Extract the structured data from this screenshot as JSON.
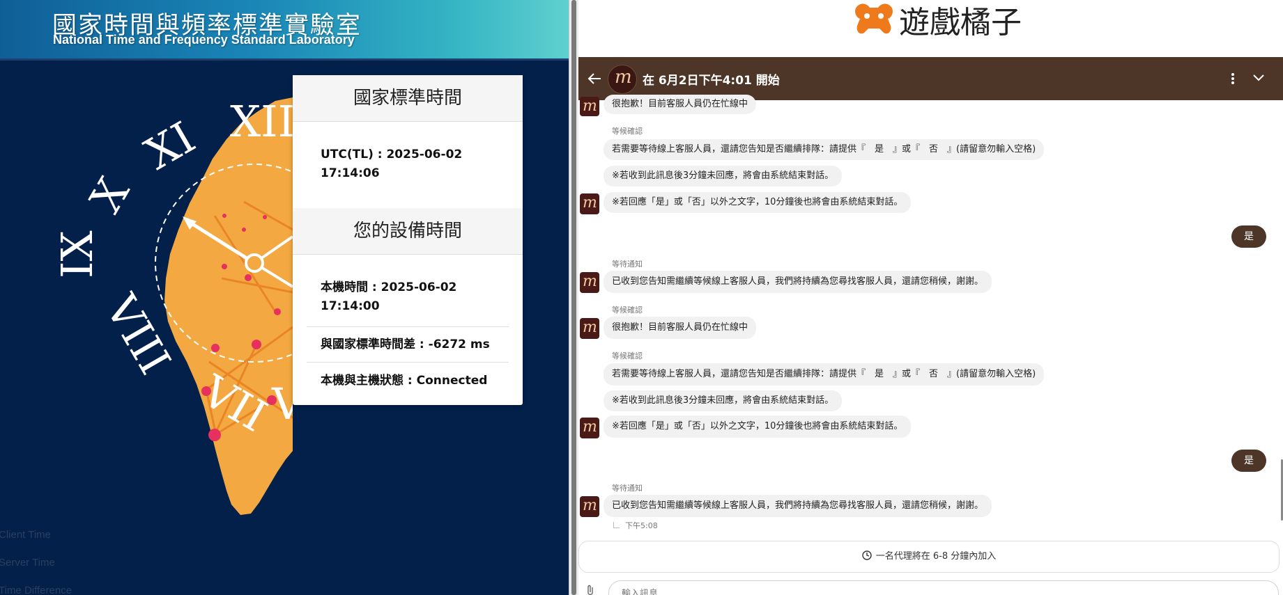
{
  "left": {
    "banner": {
      "title_zh": "國家時間與頻率標準實驗室",
      "title_en": "National Time and Frequency Standard Laboratory"
    },
    "clock": {
      "numerals": [
        "XII",
        "XI",
        "X",
        "IX",
        "VIII",
        "VII",
        "VI"
      ]
    },
    "card": {
      "std_heading": "國家標準時間",
      "utc_line1": "UTC(TL) : 2025-06-02",
      "utc_line2": "17:14:06",
      "device_heading": "您的設備時間",
      "local_line1": "本機時間 : 2025-06-02",
      "local_line2": "17:14:00",
      "diff": "與國家標準時間差 : -6272 ms",
      "status": "本機與主機狀態 : Connected"
    },
    "faint_labels": [
      "Client Time",
      "Server Time",
      "Time Difference"
    ]
  },
  "right": {
    "logo_text": "遊戲橘子",
    "chat_title": "在 6月2日下午4:01 開始",
    "messages": {
      "busy_top": "很抱歉！目前客服人員仍在忙線中",
      "label_wait_confirm": "等候確認",
      "label_wait_notice": "等待通知",
      "queue_prompt": "若需要等待線上客服人員，還請您告知是否繼續排隊：請提供『　是　』或『　否　』(請留意勿輸入空格)",
      "timeout_note": "※若收到此訊息後3分鐘未回應，將會由系統結束對話。",
      "other_text_note": "※若回應「是」或「否」以外之文字，10分鐘後也將會由系統結束對話。",
      "user_yes": "是",
      "received": "已收到您告知需繼續等候線上客服人員，我們將持續為您尋找客服人員，還請您稍候，謝謝。",
      "busy": "很抱歉！目前客服人員仍在忙線中",
      "timestamp": "下午5:08"
    },
    "join_notice": "一名代理將在 6-8 分鐘內加入",
    "input_placeholder": "輸入訊息",
    "colors": {
      "brand_brown": "#4d3627",
      "logo_orange": "#ee7a1c",
      "navy": "#02204a"
    }
  }
}
